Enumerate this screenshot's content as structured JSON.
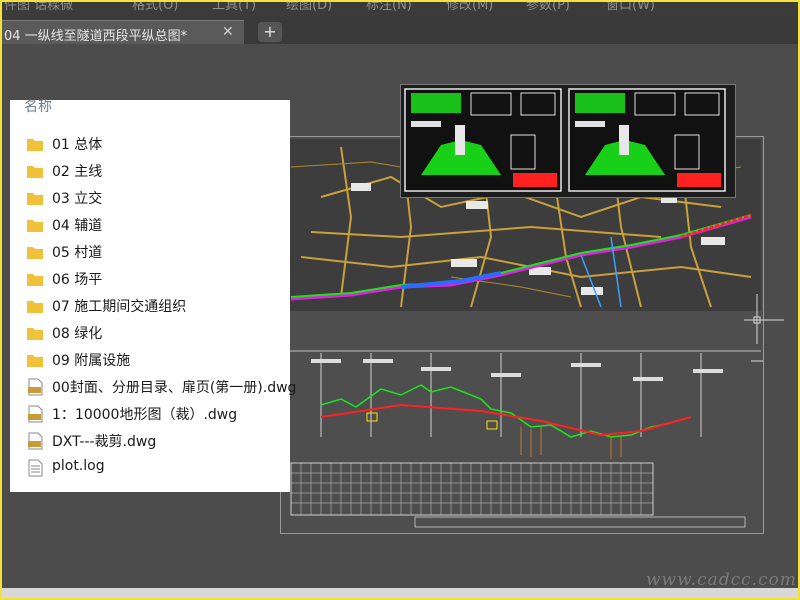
{
  "menubar": {
    "items": [
      "件图 话糅微",
      "格式(O)",
      "工具(T)",
      "绘图(D)",
      "标注(N)",
      "修改(M)",
      "参数(P)",
      "窗口(W)"
    ]
  },
  "tab": {
    "title": "04 一纵线至隧道西段平纵总图*",
    "close_glyph": "✕",
    "new_glyph": "+"
  },
  "filelist": {
    "header": "名称",
    "items": [
      {
        "type": "folder",
        "name": "01 总体"
      },
      {
        "type": "folder",
        "name": "02 主线"
      },
      {
        "type": "folder",
        "name": "03 立交"
      },
      {
        "type": "folder",
        "name": "04 辅道"
      },
      {
        "type": "folder",
        "name": "05 村道"
      },
      {
        "type": "folder",
        "name": "06 场平"
      },
      {
        "type": "folder",
        "name": "07 施工期间交通组织"
      },
      {
        "type": "folder",
        "name": "08 绿化"
      },
      {
        "type": "folder",
        "name": "09 附属设施"
      },
      {
        "type": "dwg",
        "name": "00封面、分册目录、扉页(第一册).dwg"
      },
      {
        "type": "dwg",
        "name": "1：10000地形图（裁）.dwg"
      },
      {
        "type": "dwg",
        "name": "DXT---裁剪.dwg"
      },
      {
        "type": "log",
        "name": "plot.log"
      }
    ]
  },
  "icons": {
    "folder": "folder-icon",
    "dwg": "dwg-file-icon",
    "log": "log-file-icon"
  },
  "colors": {
    "frame": "#f2e23a",
    "folder": "#f0c13a",
    "map_roads": "#c8a03c",
    "alignment_green": "#19e619",
    "alignment_red": "#ff2020",
    "alignment_magenta": "#e020e0"
  },
  "watermark": "www.cadcc.com"
}
